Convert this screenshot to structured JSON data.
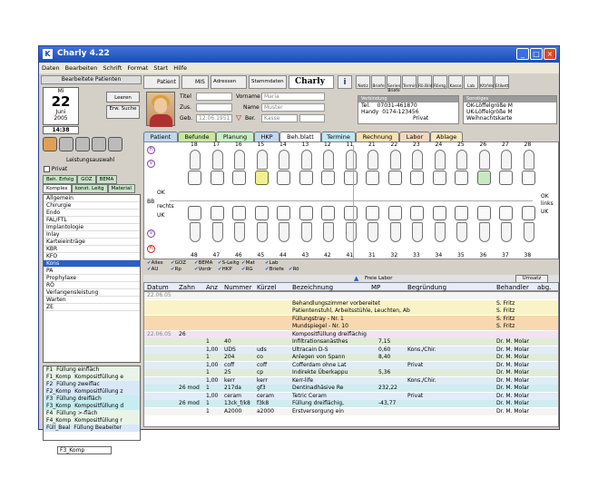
{
  "window": {
    "title": "Charly 4.22"
  },
  "menu": [
    "Daten",
    "Bearbeiten",
    "Schrift",
    "Format",
    "Start",
    "Hilfe"
  ],
  "left": {
    "header": "Bearbeitete Patienten",
    "calendar": {
      "weekday": "Mi",
      "day": "22",
      "month": "Juni",
      "year": "2005"
    },
    "time": "14:38",
    "btn_clear": "Leeren",
    "btn_search": "Erw. Suche",
    "leistungsauswahl": "Leistungsauswahl",
    "privat_label": "Privat",
    "tabs1": [
      "Beh. Erfolg",
      "GOZ",
      "BEMA"
    ],
    "tabs2": [
      "Komplex",
      "konst. Leitg",
      "Material"
    ],
    "categories": [
      "Allgemein",
      "Chirurgie",
      "Endo",
      "FAL/FTL",
      "Implantologie",
      "Inlay",
      "Karteieinträge",
      "KBR",
      "KFO",
      "Kons",
      "PA",
      "Prophylaxe",
      "RÖ",
      "Verlangensleistung",
      "Warten",
      "ZE"
    ],
    "selected_category": "Kons",
    "bottom_list": [
      {
        "code": "F1",
        "text": "Füllung einfläch"
      },
      {
        "code": "F1_Komp",
        "text": "Kompositfüllung e"
      },
      {
        "code": "F2",
        "text": "Füllung zweiflac"
      },
      {
        "code": "F2_Komp",
        "text": "Kompositfüllung z"
      },
      {
        "code": "F3",
        "text": "Füllung dreifläch"
      },
      {
        "code": "F3_Komp",
        "text": "Kompositfüllung d"
      },
      {
        "code": "F4",
        "text": "Füllung >-fläch"
      },
      {
        "code": "F4_Komp",
        "text": "Kompositfüllung r"
      },
      {
        "code": "Füll_Beal",
        "text": "Füllung Beabeiter"
      }
    ],
    "bottom_field": "F3_Komp"
  },
  "toolbar": {
    "patient": "Patient",
    "mis": "MIS",
    "adressen": "Adressen",
    "stammdaten": "Stammdaten",
    "brand": "Charly",
    "icons": [
      "Notiz",
      "Briefe",
      "Serien Briefe",
      "Termin",
      "Rö.Bild",
      "Röntg.",
      "Kasse",
      "Lab",
      "Kfz/Verr.",
      "Etikett"
    ]
  },
  "patient": {
    "titel_label": "Titel",
    "vorname_label": "Vorname",
    "vorname": "Maria",
    "zus_label": "Zus.",
    "name_label": "Name",
    "name": "Muster",
    "geb_label": "Geb.",
    "geb": "12.06.1951",
    "ber_label": "Ber.",
    "kasse": "Kasse",
    "contact_header": "Verbindung",
    "tel_label": "Tel.",
    "tel": "07031-461870",
    "handy_label": "Handy",
    "handy": "0174-123456",
    "privat": "Privat",
    "misc_header": "Sonstiges",
    "misc": [
      "OK-Löffelgröße M",
      "UK-Löffelgröße M",
      "Weihnachtskarte"
    ]
  },
  "tabs": [
    "Patient",
    "Befunde",
    "Planung",
    "HKP",
    "Beh.blatt",
    "Termine",
    "Rechnung",
    "Labor",
    "Ablage"
  ],
  "chart": {
    "upper_numbers": [
      "18",
      "17",
      "16",
      "15",
      "14",
      "13",
      "12",
      "11",
      "21",
      "22",
      "23",
      "24",
      "25",
      "26",
      "27",
      "28"
    ],
    "lower_numbers": [
      "48",
      "47",
      "46",
      "45",
      "44",
      "43",
      "42",
      "41",
      "31",
      "32",
      "33",
      "34",
      "35",
      "36",
      "37",
      "38"
    ],
    "labels_left": [
      "Fi",
      "V",
      "OK",
      "BB",
      "rechts",
      "UK",
      "V",
      "Fi"
    ],
    "labels_right": [
      "OK",
      "links",
      "UK"
    ],
    "checks": [
      "Alles",
      "GOZ",
      "BEMA",
      "S-Leitg",
      "Mat",
      "Lab",
      "AU",
      "Rp",
      "Vordr",
      "HKP",
      "RG",
      "Briefe",
      "Rö"
    ],
    "freeselabor": "Freie Labor",
    "btn_umsatz": "Umsatz"
  },
  "columns": [
    "Datum",
    "Zahn",
    "Anz",
    "Nummer",
    "Kürzel",
    "Bezeichnung",
    "MP",
    "Begründung",
    "Behandler",
    "abg."
  ],
  "rows": [
    {
      "datum": "22.06.05",
      "zahn": "",
      "anz": "",
      "nummer": "",
      "kuerzel": "",
      "bez": "",
      "mp": "",
      "beg": "",
      "beh": "",
      "color": "w"
    },
    {
      "datum": "",
      "zahn": "",
      "anz": "",
      "nummer": "",
      "kuerzel": "",
      "bez": "Behandlungszimmer vorbereitet",
      "mp": "",
      "beg": "",
      "beh": "S. Fritz",
      "color": "y"
    },
    {
      "datum": "",
      "zahn": "",
      "anz": "",
      "nummer": "",
      "kuerzel": "",
      "bez": "Patientenstuhl, Arbeitsstühle, Leuchten, Ab",
      "mp": "",
      "beg": "",
      "beh": "S. Fritz",
      "color": "y"
    },
    {
      "datum": "",
      "zahn": "",
      "anz": "",
      "nummer": "",
      "kuerzel": "",
      "bez": "Füllungstray - Nr. 1",
      "mp": "",
      "beg": "",
      "beh": "S. Fritz",
      "color": "o"
    },
    {
      "datum": "",
      "zahn": "",
      "anz": "",
      "nummer": "",
      "kuerzel": "",
      "bez": "Mundspiegel - Nr. 10",
      "mp": "",
      "beg": "",
      "beh": "S. Fritz",
      "color": "o"
    },
    {
      "datum": "22.06.05",
      "zahn": "26",
      "anz": "",
      "nummer": "",
      "kuerzel": "",
      "bez": "Kompositfüllung dreiflächig",
      "mp": "",
      "beg": "",
      "beh": "",
      "color": "p"
    },
    {
      "datum": "",
      "zahn": "",
      "anz": "1",
      "nummer": "40",
      "kuerzel": "",
      "bez": "Infiltrationsanästhes",
      "mp": "7,15",
      "beg": "",
      "beh": "Dr. M. Molar",
      "color": "g"
    },
    {
      "datum": "",
      "zahn": "",
      "anz": "1,00",
      "nummer": "UDS",
      "kuerzel": "uds",
      "bez": "Ultracain D-S",
      "mp": "0,60",
      "beg": "Kons./Chir.",
      "beh": "Dr. M. Molar",
      "color": "b"
    },
    {
      "datum": "",
      "zahn": "",
      "anz": "1",
      "nummer": "204",
      "kuerzel": "co",
      "bez": "Anlegen von Spann",
      "mp": "8,40",
      "beg": "",
      "beh": "Dr. M. Molar",
      "color": "g"
    },
    {
      "datum": "",
      "zahn": "",
      "anz": "1,00",
      "nummer": "coff",
      "kuerzel": "coff",
      "bez": "Cofferdam ohne Lat",
      "mp": "",
      "beg": "Privat",
      "beh": "Dr. M. Molar",
      "color": "b"
    },
    {
      "datum": "",
      "zahn": "",
      "anz": "1",
      "nummer": "25",
      "kuerzel": "cp",
      "bez": "Indirekte Überkappu",
      "mp": "5,36",
      "beg": "",
      "beh": "Dr. M. Molar",
      "color": "g"
    },
    {
      "datum": "",
      "zahn": "",
      "anz": "1,00",
      "nummer": "kerr",
      "kuerzel": "kerr",
      "bez": "Kerr-life",
      "mp": "",
      "beg": "Kons./Chir.",
      "beh": "Dr. M. Molar",
      "color": "b"
    },
    {
      "datum": "",
      "zahn": "26 mod",
      "anz": "1",
      "nummer": "217da",
      "kuerzel": "gf3",
      "bez": "Dentinadhäsive Re",
      "mp": "232,22",
      "beg": "",
      "beh": "Dr. M. Molar",
      "color": "c"
    },
    {
      "datum": "",
      "zahn": "",
      "anz": "1,00",
      "nummer": "ceram",
      "kuerzel": "ceram",
      "bez": "Tetric Ceram",
      "mp": "",
      "beg": "Privat",
      "beh": "Dr. M. Molar",
      "color": "b"
    },
    {
      "datum": "",
      "zahn": "26 mod",
      "anz": "1",
      "nummer": "13ck_f/k8",
      "kuerzel": "f3k8",
      "bez": "Füllung dreiflächig,",
      "mp": "-43,77",
      "beg": "",
      "beh": "Dr. M. Molar",
      "color": "c"
    },
    {
      "datum": "",
      "zahn": "",
      "anz": "1",
      "nummer": "A2000",
      "kuerzel": "a2000",
      "bez": "Erstversorgung ein",
      "mp": "",
      "beg": "",
      "beh": "Dr. M. Molar",
      "color": "w"
    }
  ]
}
